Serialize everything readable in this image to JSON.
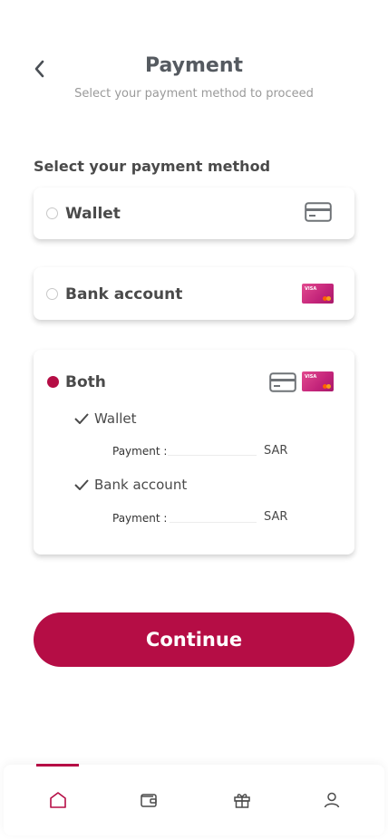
{
  "header": {
    "title": "Payment",
    "subtitle": "Select your payment method to proceed"
  },
  "section_label": "Select your payment method",
  "options": [
    {
      "label": "Wallet",
      "selected": false,
      "icon": "wallet-card-icon"
    },
    {
      "label": "Bank account",
      "selected": false,
      "icon": "visa-card-icon"
    },
    {
      "label": "Both",
      "selected": true,
      "icons": [
        "wallet-card-icon",
        "visa-card-icon"
      ],
      "sub_options": [
        {
          "label": "Wallet",
          "checked": true,
          "payment_label": "Payment :",
          "value": "",
          "currency": "SAR"
        },
        {
          "label": "Bank account",
          "checked": true,
          "payment_label": "Payment :",
          "value": "",
          "currency": "SAR"
        }
      ]
    }
  ],
  "continue_label": "Continue",
  "nav": {
    "items": [
      "home-icon",
      "wallet-icon",
      "gift-icon",
      "profile-icon"
    ],
    "active": "home-icon"
  },
  "colors": {
    "accent": "#b50d45",
    "text": "#4a4a4a",
    "muted": "#9a9a9a"
  }
}
